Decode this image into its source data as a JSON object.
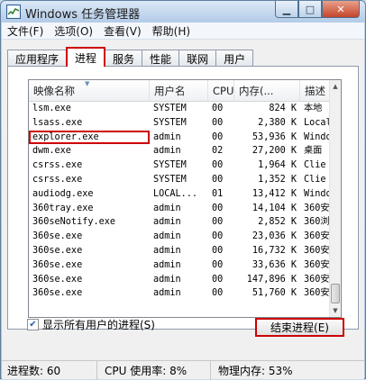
{
  "window": {
    "title": "Windows 任务管理器"
  },
  "menu": [
    "文件(F)",
    "选项(O)",
    "查看(V)",
    "帮助(H)"
  ],
  "tabs": [
    {
      "label": "应用程序",
      "active": false
    },
    {
      "label": "进程",
      "active": true
    },
    {
      "label": "服务",
      "active": false
    },
    {
      "label": "性能",
      "active": false
    },
    {
      "label": "联网",
      "active": false
    },
    {
      "label": "用户",
      "active": false
    }
  ],
  "columns": [
    "映像名称",
    "用户名",
    "CPU",
    "内存(...",
    "描述"
  ],
  "processes": [
    {
      "name": "lsm.exe",
      "user": "SYSTEM",
      "cpu": "00",
      "mem": "824 K",
      "desc": "本地"
    },
    {
      "name": "lsass.exe",
      "user": "SYSTEM",
      "cpu": "00",
      "mem": "2,380 K",
      "desc": "Local"
    },
    {
      "name": "explorer.exe",
      "user": "admin",
      "cpu": "00",
      "mem": "53,936 K",
      "desc": "Windo"
    },
    {
      "name": "dwm.exe",
      "user": "admin",
      "cpu": "02",
      "mem": "27,200 K",
      "desc": "桌面"
    },
    {
      "name": "csrss.exe",
      "user": "SYSTEM",
      "cpu": "00",
      "mem": "1,964 K",
      "desc": "Clie"
    },
    {
      "name": "csrss.exe",
      "user": "SYSTEM",
      "cpu": "00",
      "mem": "1,352 K",
      "desc": "Clie"
    },
    {
      "name": "audiodg.exe",
      "user": "LOCAL...",
      "cpu": "01",
      "mem": "13,412 K",
      "desc": "Windo"
    },
    {
      "name": "360tray.exe",
      "user": "admin",
      "cpu": "00",
      "mem": "14,104 K",
      "desc": "360安"
    },
    {
      "name": "360seNotify.exe",
      "user": "admin",
      "cpu": "00",
      "mem": "2,852 K",
      "desc": "360浏"
    },
    {
      "name": "360se.exe",
      "user": "admin",
      "cpu": "00",
      "mem": "23,036 K",
      "desc": "360安"
    },
    {
      "name": "360se.exe",
      "user": "admin",
      "cpu": "00",
      "mem": "16,732 K",
      "desc": "360安"
    },
    {
      "name": "360se.exe",
      "user": "admin",
      "cpu": "00",
      "mem": "33,636 K",
      "desc": "360安"
    },
    {
      "name": "360se.exe",
      "user": "admin",
      "cpu": "00",
      "mem": "147,896 K",
      "desc": "360安"
    },
    {
      "name": "360se.exe",
      "user": "admin",
      "cpu": "00",
      "mem": "51,760 K",
      "desc": "360安"
    }
  ],
  "highlighted_process": "explorer.exe",
  "show_all_users": {
    "label": "显示所有用户的进程(S)",
    "checked": true
  },
  "end_process_button": "结束进程(E)",
  "status": {
    "process_count": "进程数: 60",
    "cpu_usage": "CPU 使用率: 8%",
    "physical_memory": "物理内存: 53%"
  },
  "colors": {
    "highlight_outline": "#cc0000",
    "titlebar": "#b3cbe7"
  }
}
